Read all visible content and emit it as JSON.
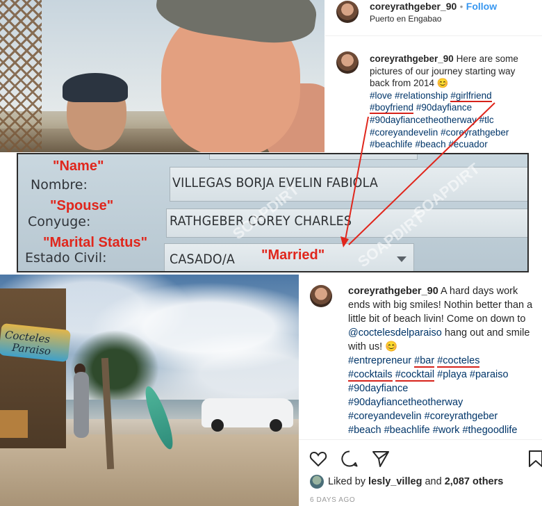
{
  "top_post": {
    "username": "coreyrathgeber_90",
    "separator": "•",
    "follow_label": "Follow",
    "location": "Puerto en Engabao",
    "caption_text": "Here are some pictures of our journey starting way back from 2014 😊",
    "hashtags": [
      "#love",
      "#relationship",
      "#girlfriend",
      "#boyfriend",
      "#90dayfiance",
      "#90dayfiancetheotherway",
      "#tlc",
      "#coreyandevelin",
      "#coreyrathgeber",
      "#beachlife",
      "#beach",
      "#ecuador"
    ]
  },
  "form": {
    "name_label": "Nombre:",
    "name_value": "VILLEGAS BORJA EVELIN FABIOLA",
    "spouse_label": "Conyuge:",
    "spouse_value": "RATHGEBER COREY CHARLES",
    "status_label": "Estado Civil:",
    "status_value": "CASADO/A",
    "annotation_name": "\"Name\"",
    "annotation_spouse": "\"Spouse\"",
    "annotation_marital": "\"Marital Status\"",
    "annotation_married": "\"Married\"",
    "watermark": "SOAPDIRT",
    "annotation_color": "#e0261c"
  },
  "bottom_post": {
    "sign_text_1": "Cocteles",
    "sign_text_2": "Paraiso",
    "username": "coreyrathgeber_90",
    "caption_text": "A hard days work ends with big smiles! Nothin better than a little bit of beach livin! Come on down to",
    "mention": "@coctelesdelparaiso",
    "caption_tail": "hang out and smile with us! 😊",
    "hashtags": [
      "#entrepreneur",
      "#bar",
      "#cocteles",
      "#cocktails",
      "#cocktail",
      "#playa",
      "#paraiso",
      "#90dayfiance",
      "#90dayfiancetheotherway",
      "#coreyandevelin",
      "#coreyrathgeber",
      "#beach",
      "#beachlife",
      "#work",
      "#thegoodlife"
    ],
    "liked_by_prefix": "Liked by",
    "liked_by_user": "lesly_villeg",
    "liked_by_and": "and",
    "liked_by_count": "2,087 others",
    "timestamp": "6 DAYS AGO",
    "icons": [
      "heart-icon",
      "comment-icon",
      "share-icon",
      "bookmark-icon"
    ]
  }
}
